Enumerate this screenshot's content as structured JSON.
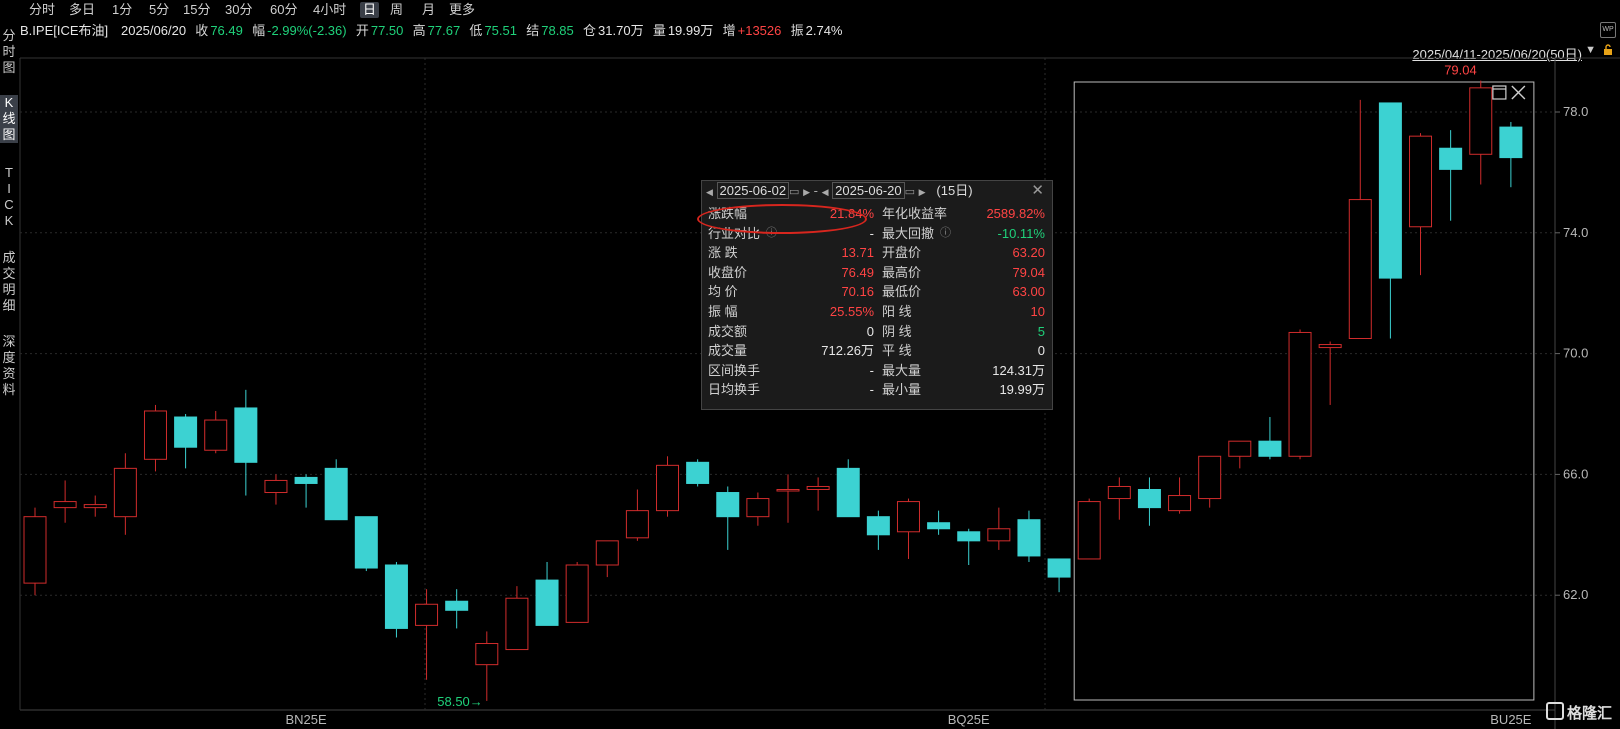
{
  "topbar": {
    "tabs": [
      "分时",
      "多日",
      "1分",
      "5分",
      "15分",
      "30分",
      "60分",
      "4小时",
      "日",
      "周",
      "月",
      "更多"
    ],
    "active": "日"
  },
  "info": {
    "symbol": "B.IPE[ICE布油]",
    "date": "2025/06/20",
    "close_label": "收",
    "close": "76.49",
    "chg_label": "幅",
    "chg": "-2.99%(-2.36)",
    "open_label": "开",
    "open": "77.50",
    "high_label": "高",
    "high": "77.67",
    "low_label": "低",
    "low": "75.51",
    "settle_label": "结",
    "settle": "78.85",
    "oi_label": "仓",
    "oi": "31.70万",
    "vol_label": "量",
    "vol": "19.99万",
    "inc_label": "增",
    "inc": "+13526",
    "amp_label": "振",
    "amp": "2.74%"
  },
  "sidebar": {
    "items": [
      "分时图",
      "K线图",
      "TICK",
      "成交明细",
      "深度资料"
    ],
    "active": "K线图"
  },
  "range_text": "2025/04/11-2025/06/20(50日)",
  "wp_icon": "WP",
  "chart_data": {
    "type": "candlestick",
    "yaxis_ticks": [
      "78.0",
      "74.0",
      "70.0",
      "66.0",
      "62.0"
    ],
    "ylim": [
      58.0,
      80.3
    ],
    "xaxis_labels": [
      {
        "label": "BN25E",
        "index": 9
      },
      {
        "label": "BQ25E",
        "index": 31
      },
      {
        "label": "BU25E",
        "index": 49
      }
    ],
    "min_marker": "58.50",
    "max_marker": "79.04",
    "candles": [
      {
        "o": 62.4,
        "c": 64.6,
        "h": 64.9,
        "l": 62.0
      },
      {
        "o": 64.9,
        "c": 65.1,
        "h": 65.8,
        "l": 64.4
      },
      {
        "o": 64.9,
        "c": 65.0,
        "h": 65.3,
        "l": 64.6
      },
      {
        "o": 64.6,
        "c": 66.2,
        "h": 66.7,
        "l": 64.0
      },
      {
        "o": 66.5,
        "c": 68.1,
        "h": 68.3,
        "l": 66.1
      },
      {
        "o": 67.9,
        "c": 66.9,
        "h": 68.0,
        "l": 66.2
      },
      {
        "o": 66.8,
        "c": 67.8,
        "h": 68.1,
        "l": 66.7
      },
      {
        "o": 68.2,
        "c": 66.4,
        "h": 68.8,
        "l": 65.3
      },
      {
        "o": 65.4,
        "c": 65.8,
        "h": 66.0,
        "l": 65.0
      },
      {
        "o": 65.9,
        "c": 65.7,
        "h": 66.0,
        "l": 64.9
      },
      {
        "o": 66.2,
        "c": 64.5,
        "h": 66.5,
        "l": 64.5
      },
      {
        "o": 64.6,
        "c": 62.9,
        "h": 64.6,
        "l": 62.8
      },
      {
        "o": 63.0,
        "c": 60.9,
        "h": 63.1,
        "l": 60.6
      },
      {
        "o": 61.0,
        "c": 61.7,
        "h": 62.2,
        "l": 59.2
      },
      {
        "o": 61.8,
        "c": 61.5,
        "h": 62.2,
        "l": 60.9
      },
      {
        "o": 59.7,
        "c": 60.4,
        "h": 60.8,
        "l": 58.5
      },
      {
        "o": 60.2,
        "c": 61.9,
        "h": 62.3,
        "l": 60.2
      },
      {
        "o": 62.5,
        "c": 61.0,
        "h": 63.1,
        "l": 61.0
      },
      {
        "o": 61.1,
        "c": 63.0,
        "h": 63.1,
        "l": 61.1
      },
      {
        "o": 63.0,
        "c": 63.8,
        "h": 63.8,
        "l": 62.6
      },
      {
        "o": 63.9,
        "c": 64.8,
        "h": 65.5,
        "l": 63.8
      },
      {
        "o": 64.8,
        "c": 66.3,
        "h": 66.6,
        "l": 64.6
      },
      {
        "o": 66.4,
        "c": 65.7,
        "h": 66.5,
        "l": 65.6
      },
      {
        "o": 65.4,
        "c": 64.6,
        "h": 65.6,
        "l": 63.5
      },
      {
        "o": 64.6,
        "c": 65.2,
        "h": 65.4,
        "l": 64.3
      },
      {
        "o": 65.5,
        "c": 65.5,
        "h": 66.0,
        "l": 64.4
      },
      {
        "o": 65.5,
        "c": 65.6,
        "h": 65.9,
        "l": 64.8
      },
      {
        "o": 66.2,
        "c": 64.6,
        "h": 66.5,
        "l": 64.6
      },
      {
        "o": 64.6,
        "c": 64.0,
        "h": 64.8,
        "l": 63.5
      },
      {
        "o": 64.1,
        "c": 65.1,
        "h": 65.2,
        "l": 63.2
      },
      {
        "o": 64.4,
        "c": 64.2,
        "h": 64.8,
        "l": 64.0
      },
      {
        "o": 64.1,
        "c": 63.8,
        "h": 64.2,
        "l": 63.0
      },
      {
        "o": 63.8,
        "c": 64.2,
        "h": 64.9,
        "l": 63.5
      },
      {
        "o": 64.5,
        "c": 63.3,
        "h": 64.8,
        "l": 63.1
      },
      {
        "o": 63.2,
        "c": 62.6,
        "h": 63.2,
        "l": 62.1
      },
      {
        "o": 63.2,
        "c": 65.1,
        "h": 65.2,
        "l": 63.2
      },
      {
        "o": 65.2,
        "c": 65.6,
        "h": 65.9,
        "l": 64.5
      },
      {
        "o": 65.5,
        "c": 64.9,
        "h": 65.9,
        "l": 64.3
      },
      {
        "o": 64.8,
        "c": 65.3,
        "h": 65.9,
        "l": 64.7
      },
      {
        "o": 65.2,
        "c": 66.6,
        "h": 66.6,
        "l": 64.9
      },
      {
        "o": 66.6,
        "c": 67.1,
        "h": 67.1,
        "l": 66.2
      },
      {
        "o": 67.1,
        "c": 66.6,
        "h": 67.9,
        "l": 66.5
      },
      {
        "o": 66.6,
        "c": 70.7,
        "h": 70.8,
        "l": 66.5
      },
      {
        "o": 70.2,
        "c": 70.3,
        "h": 70.4,
        "l": 68.3
      },
      {
        "o": 70.5,
        "c": 75.1,
        "h": 78.4,
        "l": 70.5
      },
      {
        "o": 78.3,
        "c": 72.5,
        "h": 78.3,
        "l": 70.5
      },
      {
        "o": 74.2,
        "c": 77.2,
        "h": 77.3,
        "l": 72.6
      },
      {
        "o": 76.8,
        "c": 76.1,
        "h": 77.4,
        "l": 74.4
      },
      {
        "o": 76.6,
        "c": 78.8,
        "h": 79.04,
        "l": 75.6
      },
      {
        "o": 77.5,
        "c": 76.49,
        "h": 77.67,
        "l": 75.51
      }
    ]
  },
  "popup": {
    "start_date": "2025-06-02",
    "end_date": "2025-06-20",
    "days": "(15日)",
    "rows": [
      {
        "l1": "涨跌幅",
        "v1": "21.84%",
        "c1": "red",
        "l2": "年化收益率",
        "v2": "2589.82%",
        "c2": "red"
      },
      {
        "l1": "行业对比",
        "v1": "-",
        "c1": "white",
        "l2": "最大回撤",
        "v2": "-10.11%",
        "c2": "green"
      },
      {
        "l1": "涨  跌",
        "v1": "13.71",
        "c1": "red",
        "l2": "开盘价",
        "v2": "63.20",
        "c2": "red"
      },
      {
        "l1": "收盘价",
        "v1": "76.49",
        "c1": "red",
        "l2": "最高价",
        "v2": "79.04",
        "c2": "red"
      },
      {
        "l1": "均  价",
        "v1": "70.16",
        "c1": "red",
        "l2": "最低价",
        "v2": "63.00",
        "c2": "red"
      },
      {
        "l1": "振  幅",
        "v1": "25.55%",
        "c1": "red",
        "l2": "阳  线",
        "v2": "10",
        "c2": "red"
      },
      {
        "l1": "成交额",
        "v1": "0",
        "c1": "white",
        "l2": "阴  线",
        "v2": "5",
        "c2": "green"
      },
      {
        "l1": "成交量",
        "v1": "712.26万",
        "c1": "white",
        "l2": "平  线",
        "v2": "0",
        "c2": "white"
      },
      {
        "l1": "区间换手",
        "v1": "-",
        "c1": "white",
        "l2": "最大量",
        "v2": "124.31万",
        "c2": "white"
      },
      {
        "l1": "日均换手",
        "v1": "-",
        "c1": "white",
        "l2": "最小量",
        "v2": "19.99万",
        "c2": "white"
      }
    ]
  },
  "colors": {
    "up": "#d12c2c",
    "down": "#3cd2d2",
    "grid": "#2a2a2a",
    "axis_text": "#b8b8b8",
    "selection": "#bdbdbd"
  },
  "logo": "格隆汇"
}
